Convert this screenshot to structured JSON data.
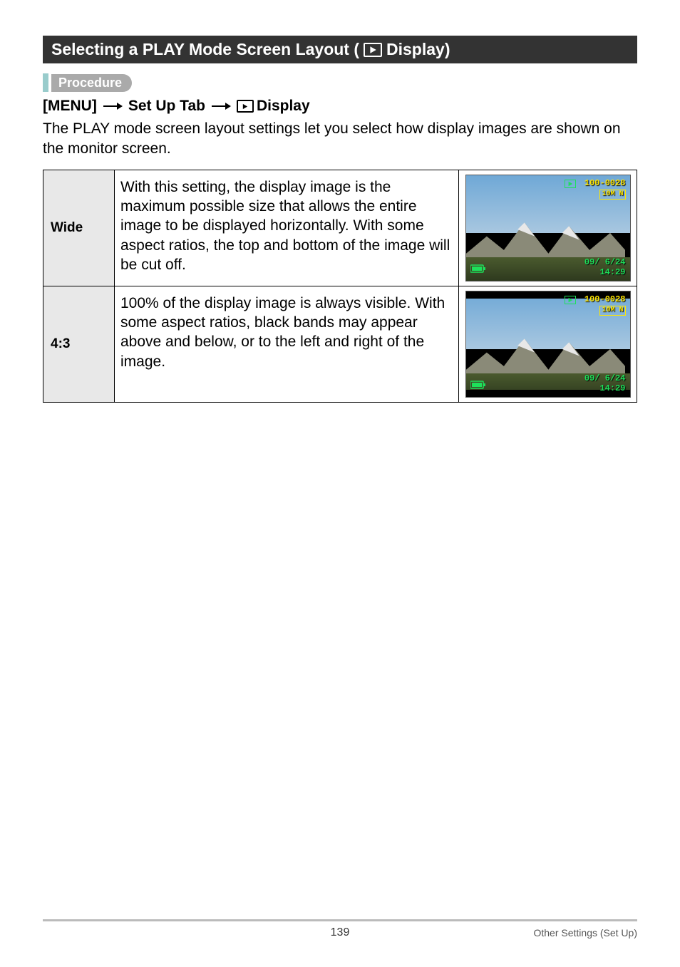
{
  "title": {
    "prefix": "Selecting a PLAY Mode Screen Layout (",
    "suffix": " Display)"
  },
  "procedure_label": "Procedure",
  "nav": {
    "menu": "[MENU]",
    "setup": "Set Up Tab",
    "display": "Display"
  },
  "description": "The PLAY mode screen layout settings let you select how display images are shown on the monitor screen.",
  "rows": [
    {
      "label": "Wide",
      "text": "With this setting, the display image is the maximum possible size that allows the entire image to be displayed horizontally. With some aspect ratios, the top and bottom of the image will be cut off.",
      "overlay_tr_line1": "100-0028",
      "overlay_tr_badge": "10M N",
      "overlay_br_line1": "09/ 6/24",
      "overlay_br_line2": "14:29",
      "narrow": false
    },
    {
      "label": "4:3",
      "text": "100% of the display image is always visible. With some aspect ratios, black bands may appear above and below, or to the left and right of the image.",
      "overlay_tr_line1": "100-0028",
      "overlay_tr_badge": "10M N",
      "overlay_br_line1": "09/ 6/24",
      "overlay_br_line2": "14:29",
      "narrow": true
    }
  ],
  "footer": {
    "page": "139",
    "section": "Other Settings (Set Up)"
  }
}
